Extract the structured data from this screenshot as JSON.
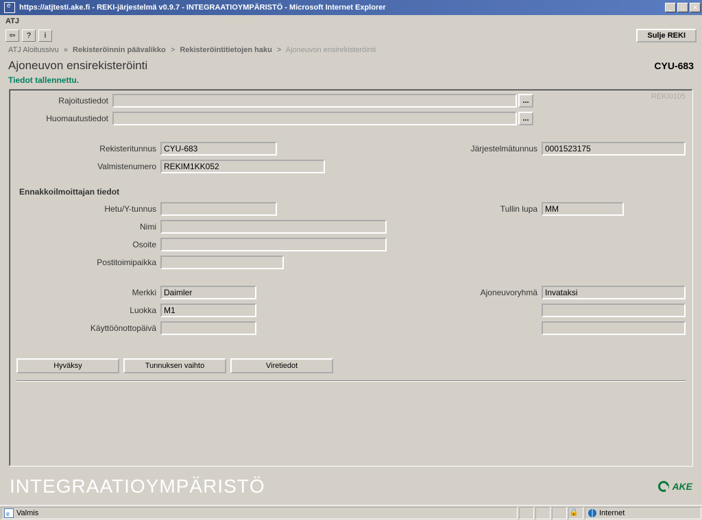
{
  "window": {
    "title": "https://atjtesti.ake.fi - REKI-järjestelmä v0.9.7 - INTEGRAATIOYMPÄRISTÖ - Microsoft Internet Explorer"
  },
  "menubar": {
    "atj": "ATJ"
  },
  "toolbar": {
    "back_glyph": "⇦",
    "help_glyph": "?",
    "info_glyph": "i",
    "close_label": "Sulje REKI"
  },
  "breadcrumb": {
    "item1": "ATJ Aloitussivu",
    "item2": "Rekisteröinnin päävalikko",
    "item3": "Rekisteröintitietojen haku",
    "item4": "Ajoneuvon ensirekisteröinti",
    "sep": ">",
    "sep1": "»"
  },
  "page": {
    "title": "Ajoneuvon ensirekisteröinti",
    "reg_id": "CYU-683",
    "status": "Tiedot tallennettu.",
    "screen_code": "REKI0105"
  },
  "labels": {
    "rajoitustiedot": "Rajoitustiedot",
    "huomautustiedot": "Huomautustiedot",
    "rekisteritunnus": "Rekisteritunnus",
    "jarjestelmatunnus": "Järjestelmätunnus",
    "valmistenumero": "Valmistenumero",
    "hetu": "Hetu/Y-tunnus",
    "tullin_lupa": "Tullin lupa",
    "nimi": "Nimi",
    "osoite": "Osoite",
    "postitoimipaikka": "Postitoimipaikka",
    "merkki": "Merkki",
    "ajoneuvoryhma": "Ajoneuvoryhmä",
    "luokka": "Luokka",
    "kayttoonottopaiva": "Käyttöönottopäivä",
    "ennakkoilmoittajan": "Ennakkoilmoittajan tiedot",
    "dots": "..."
  },
  "values": {
    "rajoitustiedot": "",
    "huomautustiedot": "",
    "rekisteritunnus": "CYU-683",
    "jarjestelmatunnus": "0001523175",
    "valmistenumero": "REKIM1KK052",
    "hetu": "",
    "tullin_lupa": "MM",
    "nimi": "",
    "osoite": "",
    "postitoimipaikka": "",
    "merkki": "Daimler",
    "ajoneuvoryhma": "Invataksi",
    "luokka": "M1",
    "kayttoonottopaiva": "",
    "extra1": "",
    "extra2": ""
  },
  "buttons": {
    "hyvaksy": "Hyväksy",
    "tunnuksen_vaihto": "Tunnuksen vaihto",
    "viretiedot": "Viretiedot"
  },
  "footer": {
    "env": "INTEGRAATIOYMPÄRISTÖ",
    "ake": "AKE"
  },
  "statusbar": {
    "ready": "Valmis",
    "zone": "Internet"
  }
}
